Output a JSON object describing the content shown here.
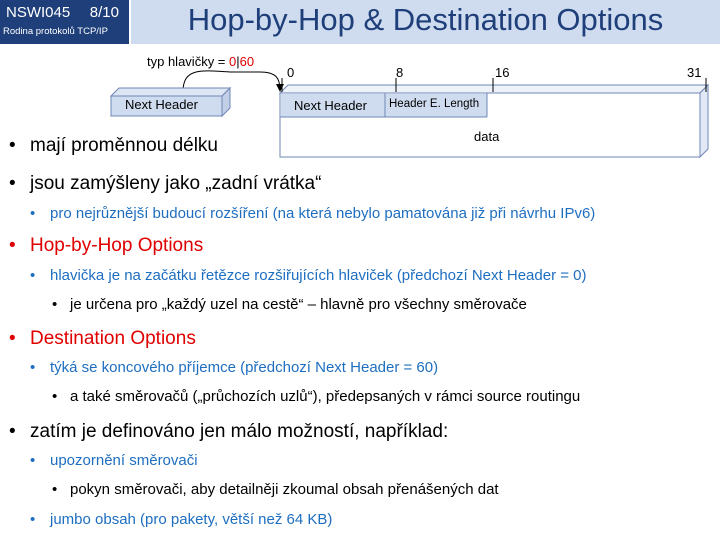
{
  "header": {
    "course_code": "NSWI045",
    "slide_number": "8/10",
    "course_name": "Rodina protokolů TCP/IP",
    "title": "Hop-by-Hop & Destination Options"
  },
  "diagram": {
    "type_label_prefix": "typ hlavičky = ",
    "type_value_a": "0",
    "type_sep": "|",
    "type_value_b": "60",
    "prev_header_label": "Next Header",
    "ticks": [
      "0",
      "8",
      "16",
      "31"
    ],
    "field_next_header": "Next Header",
    "field_length": "Header E. Length",
    "field_data": "data"
  },
  "bullets": [
    {
      "level": 1,
      "text": "mají proměnnou délku",
      "color": "#000000"
    },
    {
      "level": 1,
      "text": "jsou zamýšleny jako „zadní vrátka“",
      "color": "#000000"
    },
    {
      "level": 2,
      "text": "pro nejrůznější budoucí rozšíření (na která nebylo pamatována již při návrhu IPv6)"
    },
    {
      "level": 1,
      "text": "Hop-by-Hop Options",
      "color": "#e00000"
    },
    {
      "level": 2,
      "text": "hlavička je na začátku řetězce rozšiřujících hlaviček (předchozí Next Header = 0)"
    },
    {
      "level": 3,
      "text": "je určena pro „každý uzel na cestě“ – hlavně pro všechny směrovače"
    },
    {
      "level": 1,
      "text": "Destination Options",
      "color": "#e00000"
    },
    {
      "level": 2,
      "text": "týká se koncového příjemce (předchozí Next Header = 60)"
    },
    {
      "level": 3,
      "text": "a také směrovačů („průchozích uzlů“), předepsaných v rámci source routingu"
    },
    {
      "level": 1,
      "text": "zatím je definováno jen málo možností, například:",
      "color": "#000000"
    },
    {
      "level": 2,
      "text": "upozornění směrovači"
    },
    {
      "level": 3,
      "text": "pokyn směrovači, aby detailněji zkoumal obsah přenášených dat"
    },
    {
      "level": 2,
      "text": "jumbo obsah (pro pakety, větší než 64 KB)"
    }
  ]
}
